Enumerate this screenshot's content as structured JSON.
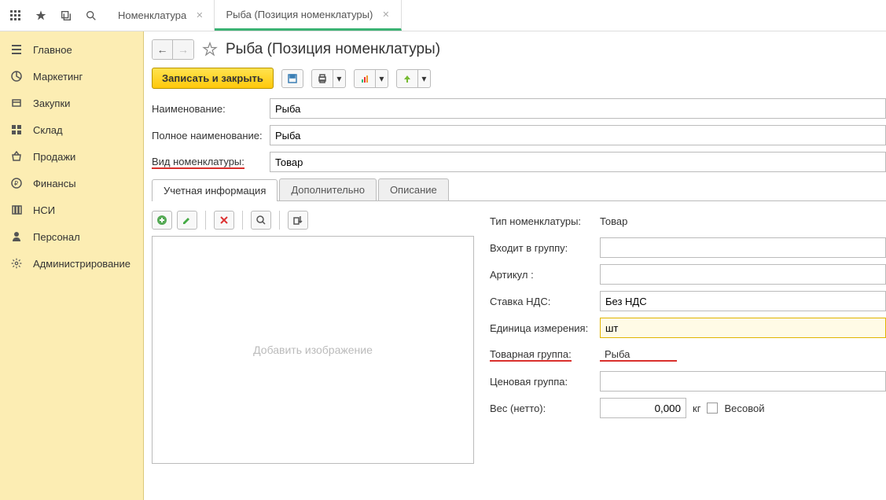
{
  "tabs": [
    {
      "label": "Номенклатура"
    },
    {
      "label": "Рыба (Позиция номенклатуры)"
    }
  ],
  "sidebar": [
    {
      "label": "Главное",
      "icon": "menu"
    },
    {
      "label": "Маркетинг",
      "icon": "pie"
    },
    {
      "label": "Закупки",
      "icon": "cart"
    },
    {
      "label": "Склад",
      "icon": "grid"
    },
    {
      "label": "Продажи",
      "icon": "basket"
    },
    {
      "label": "Финансы",
      "icon": "ruble"
    },
    {
      "label": "НСИ",
      "icon": "books"
    },
    {
      "label": "Персонал",
      "icon": "person"
    },
    {
      "label": "Администрирование",
      "icon": "gear"
    }
  ],
  "page": {
    "title": "Рыба (Позиция номенклатуры)",
    "save_close": "Записать и закрыть"
  },
  "form": {
    "name_label": "Наименование:",
    "name_value": "Рыба",
    "fullname_label": "Полное наименование:",
    "fullname_value": "Рыба",
    "kind_label": "Вид номенклатуры:",
    "kind_value": "Товар"
  },
  "subtabs": [
    "Учетная информация",
    "Дополнительно",
    "Описание"
  ],
  "image_placeholder": "Добавить изображение",
  "props": {
    "type_label": "Тип номенклатуры:",
    "type_value": "Товар",
    "group_label": "Входит в группу:",
    "group_value": "",
    "article_label": "Артикул :",
    "article_value": "",
    "vat_label": "Ставка НДС:",
    "vat_value": "Без НДС",
    "unit_label": "Единица измерения:",
    "unit_value": "шт",
    "prodgroup_label": "Товарная группа:",
    "prodgroup_value": "Рыба",
    "pricegroup_label": "Ценовая группа:",
    "pricegroup_value": "",
    "weight_label": "Вес (нетто):",
    "weight_value": "0,000",
    "weight_unit": "кг",
    "weight_flag": "Весовой"
  }
}
